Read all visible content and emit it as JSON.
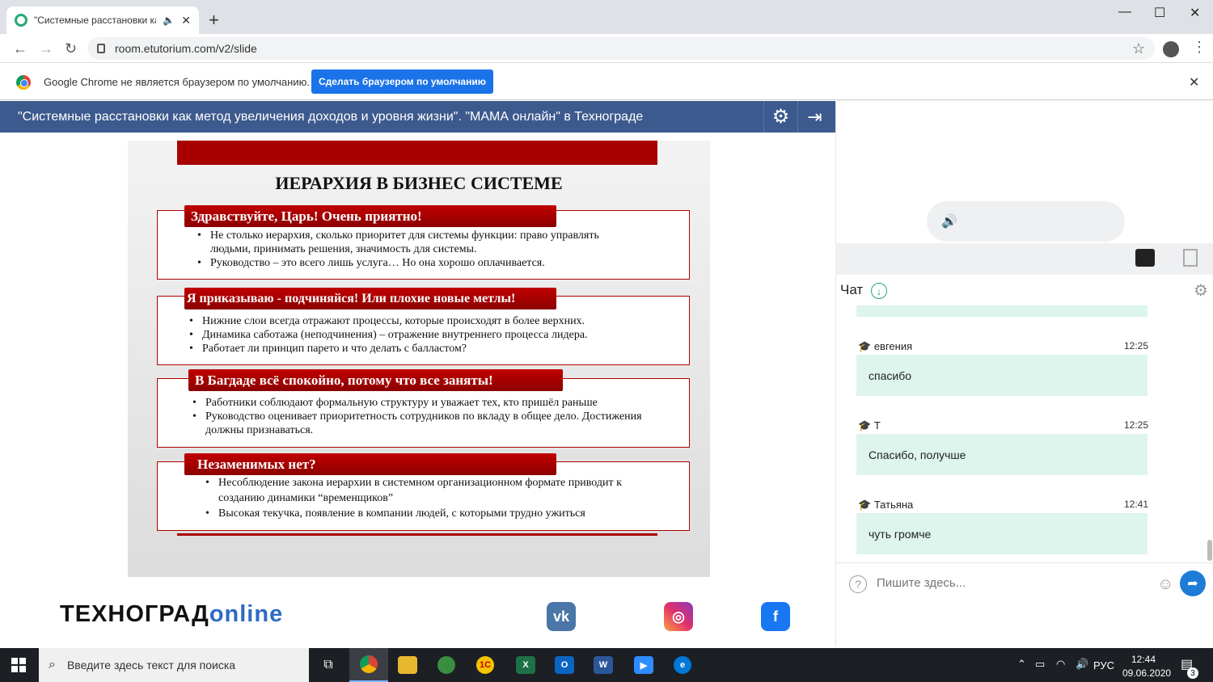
{
  "browser": {
    "tab_title": "\"Системные расстановки ка",
    "url": "room.etutorium.com/v2/slide",
    "infobar_text": "Google Chrome не является браузером по умолчанию.",
    "set_default_label": "Сделать браузером по умолчанию"
  },
  "webinar": {
    "title": "\"Системные расстановки как метод увеличения доходов и уровня жизни\". \"МАМА онлайн\" в Технограде"
  },
  "slide": {
    "title": "ИЕРАРХИЯ В БИЗНЕС СИСТЕМЕ",
    "sections": [
      {
        "heading": "Здравствуйте, Царь! Очень приятно!",
        "bullets": [
          "Не столько иерархия, сколько приоритет для системы функции: право управлять людьми, принимать решения, значимость для системы.",
          "Руководство – это всего лишь услуга… Но она хорошо оплачивается."
        ]
      },
      {
        "heading": "Я приказываю - подчиняйся! Или плохие новые метлы!",
        "bullets": [
          "Нижние слои всегда отражают процессы, которые происходят в более верхних.",
          "Динамика саботажа (неподчинения) – отражение внутреннего процесса лидера.",
          "Работает ли принцип парето и что делать с балластом?"
        ]
      },
      {
        "heading": "В Багдаде всё спокойно, потому что все заняты!",
        "bullets": [
          "Работники соблюдают формальную структуру и  уважает тех, кто пришёл раньше",
          "Руководство оценивает приоритетность сотрудников по вкладу в общее дело. Достижения должны признаваться."
        ]
      },
      {
        "heading": "Незаменимых нет?",
        "bullets": [
          "Несоблюдение закона иерархии в системном организационном формате приводит к созданию динамики “временщиков”",
          "Высокая текучка, появление в компании людей, с которыми трудно ужиться"
        ]
      }
    ]
  },
  "footer": {
    "logo_main": "ТЕХНОГРАД",
    "logo_accent": "online"
  },
  "chat": {
    "heading": "Чат",
    "messages": [
      {
        "author": "евгения",
        "time": "12:25",
        "text": "спасибо"
      },
      {
        "author": "Т",
        "time": "12:25",
        "text": "Спасибо, получше"
      },
      {
        "author": "Татьяна",
        "time": "12:41",
        "text": "чуть громче"
      }
    ],
    "input_placeholder": "Пишите здесь..."
  },
  "taskbar": {
    "search_placeholder": "Введите здесь текст для поиска",
    "lang": "РУС",
    "time": "12:44",
    "date": "09.06.2020",
    "notifications": "3"
  },
  "colors": {
    "header_blue": "#3d5a8e",
    "slide_red": "#a80000",
    "chat_bubble": "#ddf5ec",
    "accent_green": "#2aa876"
  }
}
